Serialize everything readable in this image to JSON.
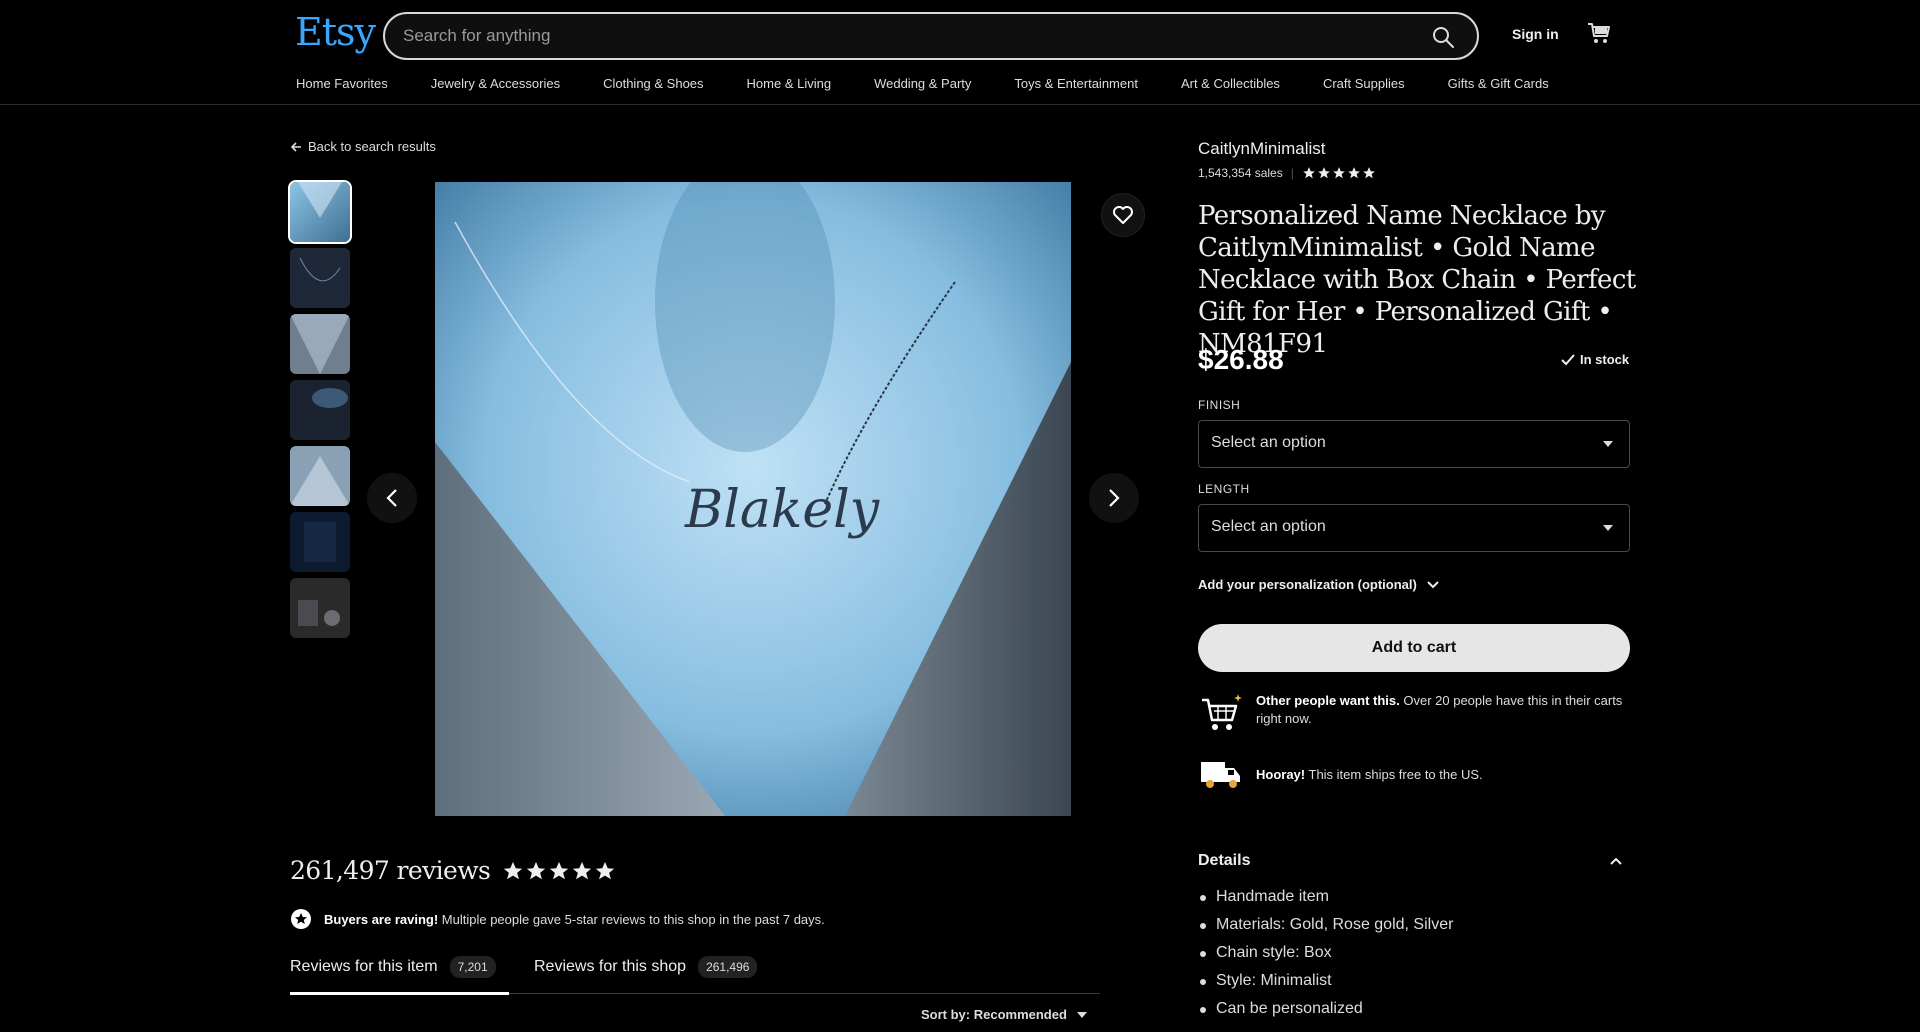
{
  "header": {
    "logo": "Etsy",
    "search_placeholder": "Search for anything",
    "sign_in": "Sign in"
  },
  "categories": [
    "Home Favorites",
    "Jewelry & Accessories",
    "Clothing & Shoes",
    "Home & Living",
    "Wedding & Party",
    "Toys & Entertainment",
    "Art & Collectibles",
    "Craft Supplies",
    "Gifts & Gift Cards"
  ],
  "listing": {
    "back_label": "Back to search results",
    "shop_name": "CaitlynMinimalist",
    "sales": "1,543,354 sales",
    "title": "Personalized Name Necklace by CaitlynMinimalist • Gold Name Necklace with Box Chain • Perfect Gift for Her • Personalized Gift • NM81F91",
    "price": "$26.88",
    "stock": "In stock",
    "finish_label": "FINISH",
    "finish_value": "Select an option",
    "length_label": "LENGTH",
    "length_value": "Select an option",
    "personalization": "Add your personalization (optional)",
    "add_to_cart": "Add to cart",
    "image_text": "Blakely"
  },
  "promos": {
    "demand_bold": "Other people want this.",
    "demand_text": " Over 20 people have this in their carts right now.",
    "ship_bold": "Hooray!",
    "ship_text": " This item ships free to the US."
  },
  "details": {
    "heading": "Details",
    "items": [
      "Handmade item",
      "Materials: Gold, Rose gold, Silver",
      "Chain style: Box",
      "Style: Minimalist",
      "Can be personalized"
    ]
  },
  "reviews": {
    "heading": "261,497 reviews",
    "raving_bold": "Buyers are raving!",
    "raving_text": " Multiple people gave 5-star reviews to this shop in the past 7 days.",
    "tab_item": "Reviews for this item",
    "tab_item_count": "7,201",
    "tab_shop": "Reviews for this shop",
    "tab_shop_count": "261,496",
    "sort": "Sort by: Recommended"
  },
  "colors": {
    "brand": "#3aa7ff",
    "background": "#000000",
    "button": "#e6e6e6"
  }
}
